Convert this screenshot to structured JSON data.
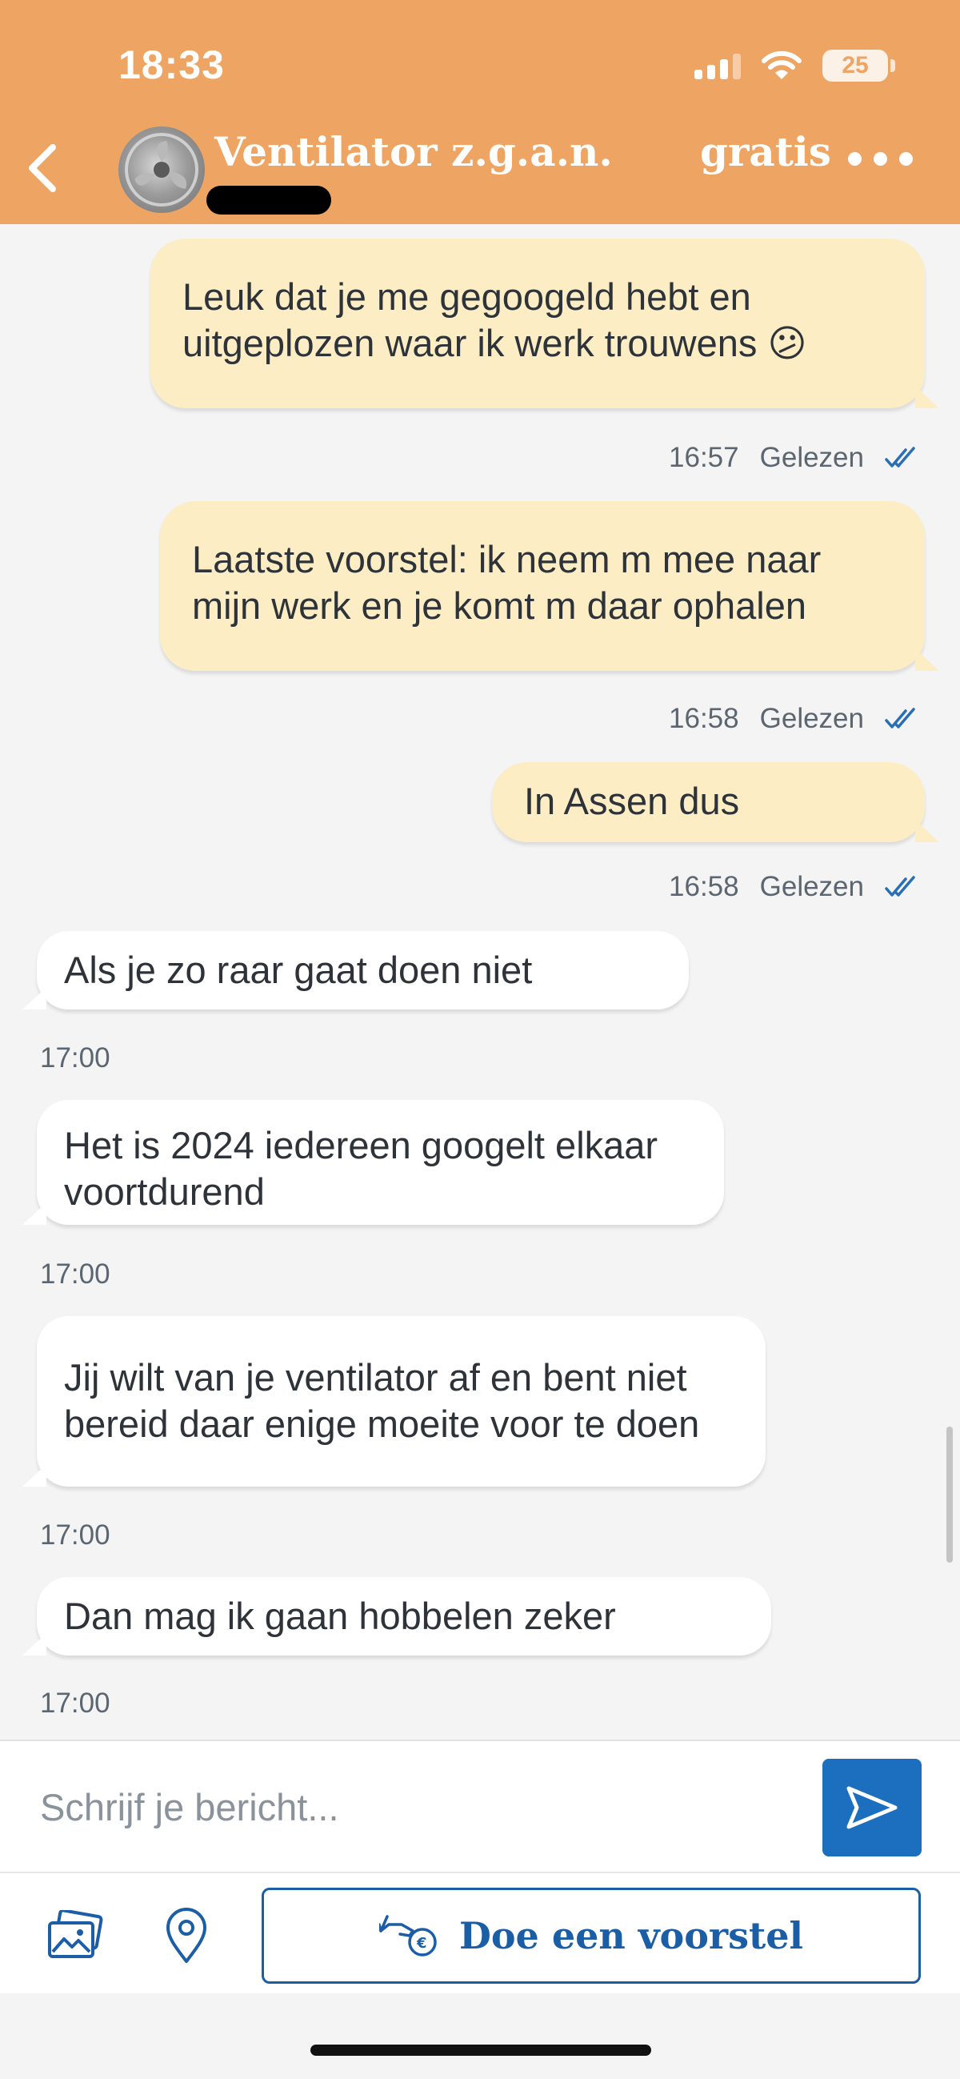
{
  "status_bar": {
    "time": "18:33",
    "battery": "25",
    "icons": [
      "signal-icon",
      "wifi-icon",
      "battery-icon"
    ]
  },
  "header": {
    "title": "Ventilator z.g.a.n.",
    "price": "gratis",
    "back_icon": "chevron-left-icon",
    "more_icon": "more-dots-icon",
    "background_color": "#eea462"
  },
  "messages": [
    {
      "direction": "outgoing",
      "text": "Leuk dat je me gegoogeld hebt en\nuitgeplozen waar ik werk trouwens 😕",
      "time": "16:57",
      "status": "Gelezen"
    },
    {
      "direction": "outgoing",
      "text": "Laatste voorstel: ik neem m mee naar\nmijn werk en je komt m daar ophalen",
      "time": "16:58",
      "status": "Gelezen"
    },
    {
      "direction": "outgoing",
      "text": "In Assen dus",
      "time": "16:58",
      "status": "Gelezen"
    },
    {
      "direction": "incoming",
      "text": "Als je zo raar gaat doen niet",
      "time": "17:00"
    },
    {
      "direction": "incoming",
      "text": "Het is 2024 iedereen googelt elkaar\nvoortdurend",
      "time": "17:00"
    },
    {
      "direction": "incoming",
      "text": "Jij wilt van je ventilator af en bent niet\nbereid daar enige moeite voor te doen",
      "time": "17:00"
    },
    {
      "direction": "incoming",
      "text": "Dan mag ik gaan hobbelen zeker",
      "time": "17:00"
    }
  ],
  "composer": {
    "placeholder": "Schrijf je bericht...",
    "value": "",
    "send_icon": "send-icon"
  },
  "actions": {
    "photo_icon": "photo-icon",
    "location_icon": "location-pin-icon",
    "offer_icon": "hand-coin-icon",
    "offer_label": "Doe een voorstel"
  },
  "colors": {
    "outgoing_bubble": "#fcedc5",
    "incoming_bubble": "#ffffff",
    "accent_blue": "#1b6fbe",
    "read_check": "#2a6eb5"
  }
}
